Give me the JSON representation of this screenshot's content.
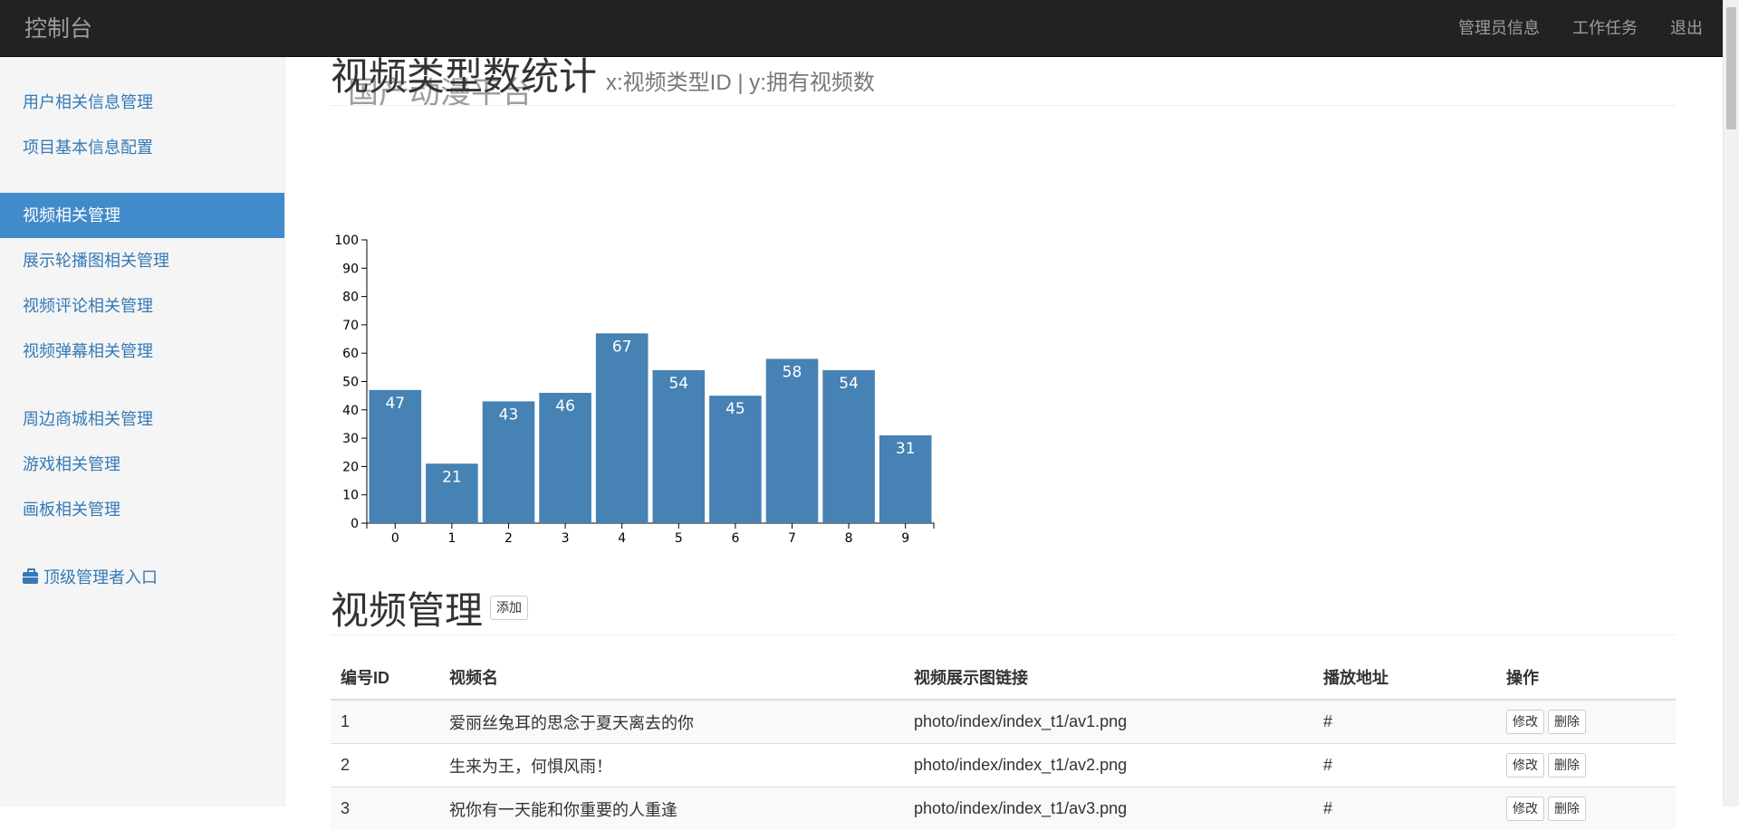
{
  "navbar": {
    "brand": "国产动漫平台",
    "brand_sub": "控制台",
    "links": [
      "管理员信息",
      "工作任务",
      "退出"
    ]
  },
  "sidebar": {
    "group1": [
      "用户相关信息管理",
      "项目基本信息配置"
    ],
    "group2": [
      "视频相关管理",
      "展示轮播图相关管理",
      "视频评论相关管理",
      "视频弹幕相关管理"
    ],
    "group3": [
      "周边商城相关管理",
      "游戏相关管理",
      "画板相关管理"
    ],
    "admin_entry": "顶级管理者入口",
    "active_item": "视频相关管理"
  },
  "stats_header": {
    "title": "视频类型数统计",
    "subtitle": "x:视频类型ID | y:拥有视频数"
  },
  "chart_data": {
    "type": "bar",
    "categories": [
      "0",
      "1",
      "2",
      "3",
      "4",
      "5",
      "6",
      "7",
      "8",
      "9"
    ],
    "values": [
      47,
      21,
      43,
      46,
      67,
      54,
      45,
      58,
      54,
      31
    ],
    "title": "",
    "xlabel": "",
    "ylabel": "",
    "ylim": [
      0,
      100
    ],
    "yticks": [
      0,
      10,
      20,
      30,
      40,
      50,
      60,
      70,
      80,
      90,
      100
    ],
    "bar_color": "#4682b4",
    "label_color": "#ffffff",
    "grid": false
  },
  "video_section": {
    "title": "视频管理",
    "add_label": "添加",
    "columns": [
      "编号ID",
      "视频名",
      "视频展示图链接",
      "播放地址",
      "操作"
    ],
    "rows": [
      {
        "id": "1",
        "name": "爱丽丝兔耳的思念于夏天离去的你",
        "image": "photo/index/index_t1/av1.png",
        "url": "#"
      },
      {
        "id": "2",
        "name": "生来为王，何惧风雨！",
        "image": "photo/index/index_t1/av2.png",
        "url": "#"
      },
      {
        "id": "3",
        "name": "祝你有一天能和你重要的人重逢",
        "image": "photo/index/index_t1/av3.png",
        "url": "#"
      }
    ],
    "edit_label": "修改",
    "delete_label": "删除"
  },
  "colors": {
    "navbar_bg": "#222222",
    "active_bg": "#428bca",
    "link": "#337ab7"
  }
}
